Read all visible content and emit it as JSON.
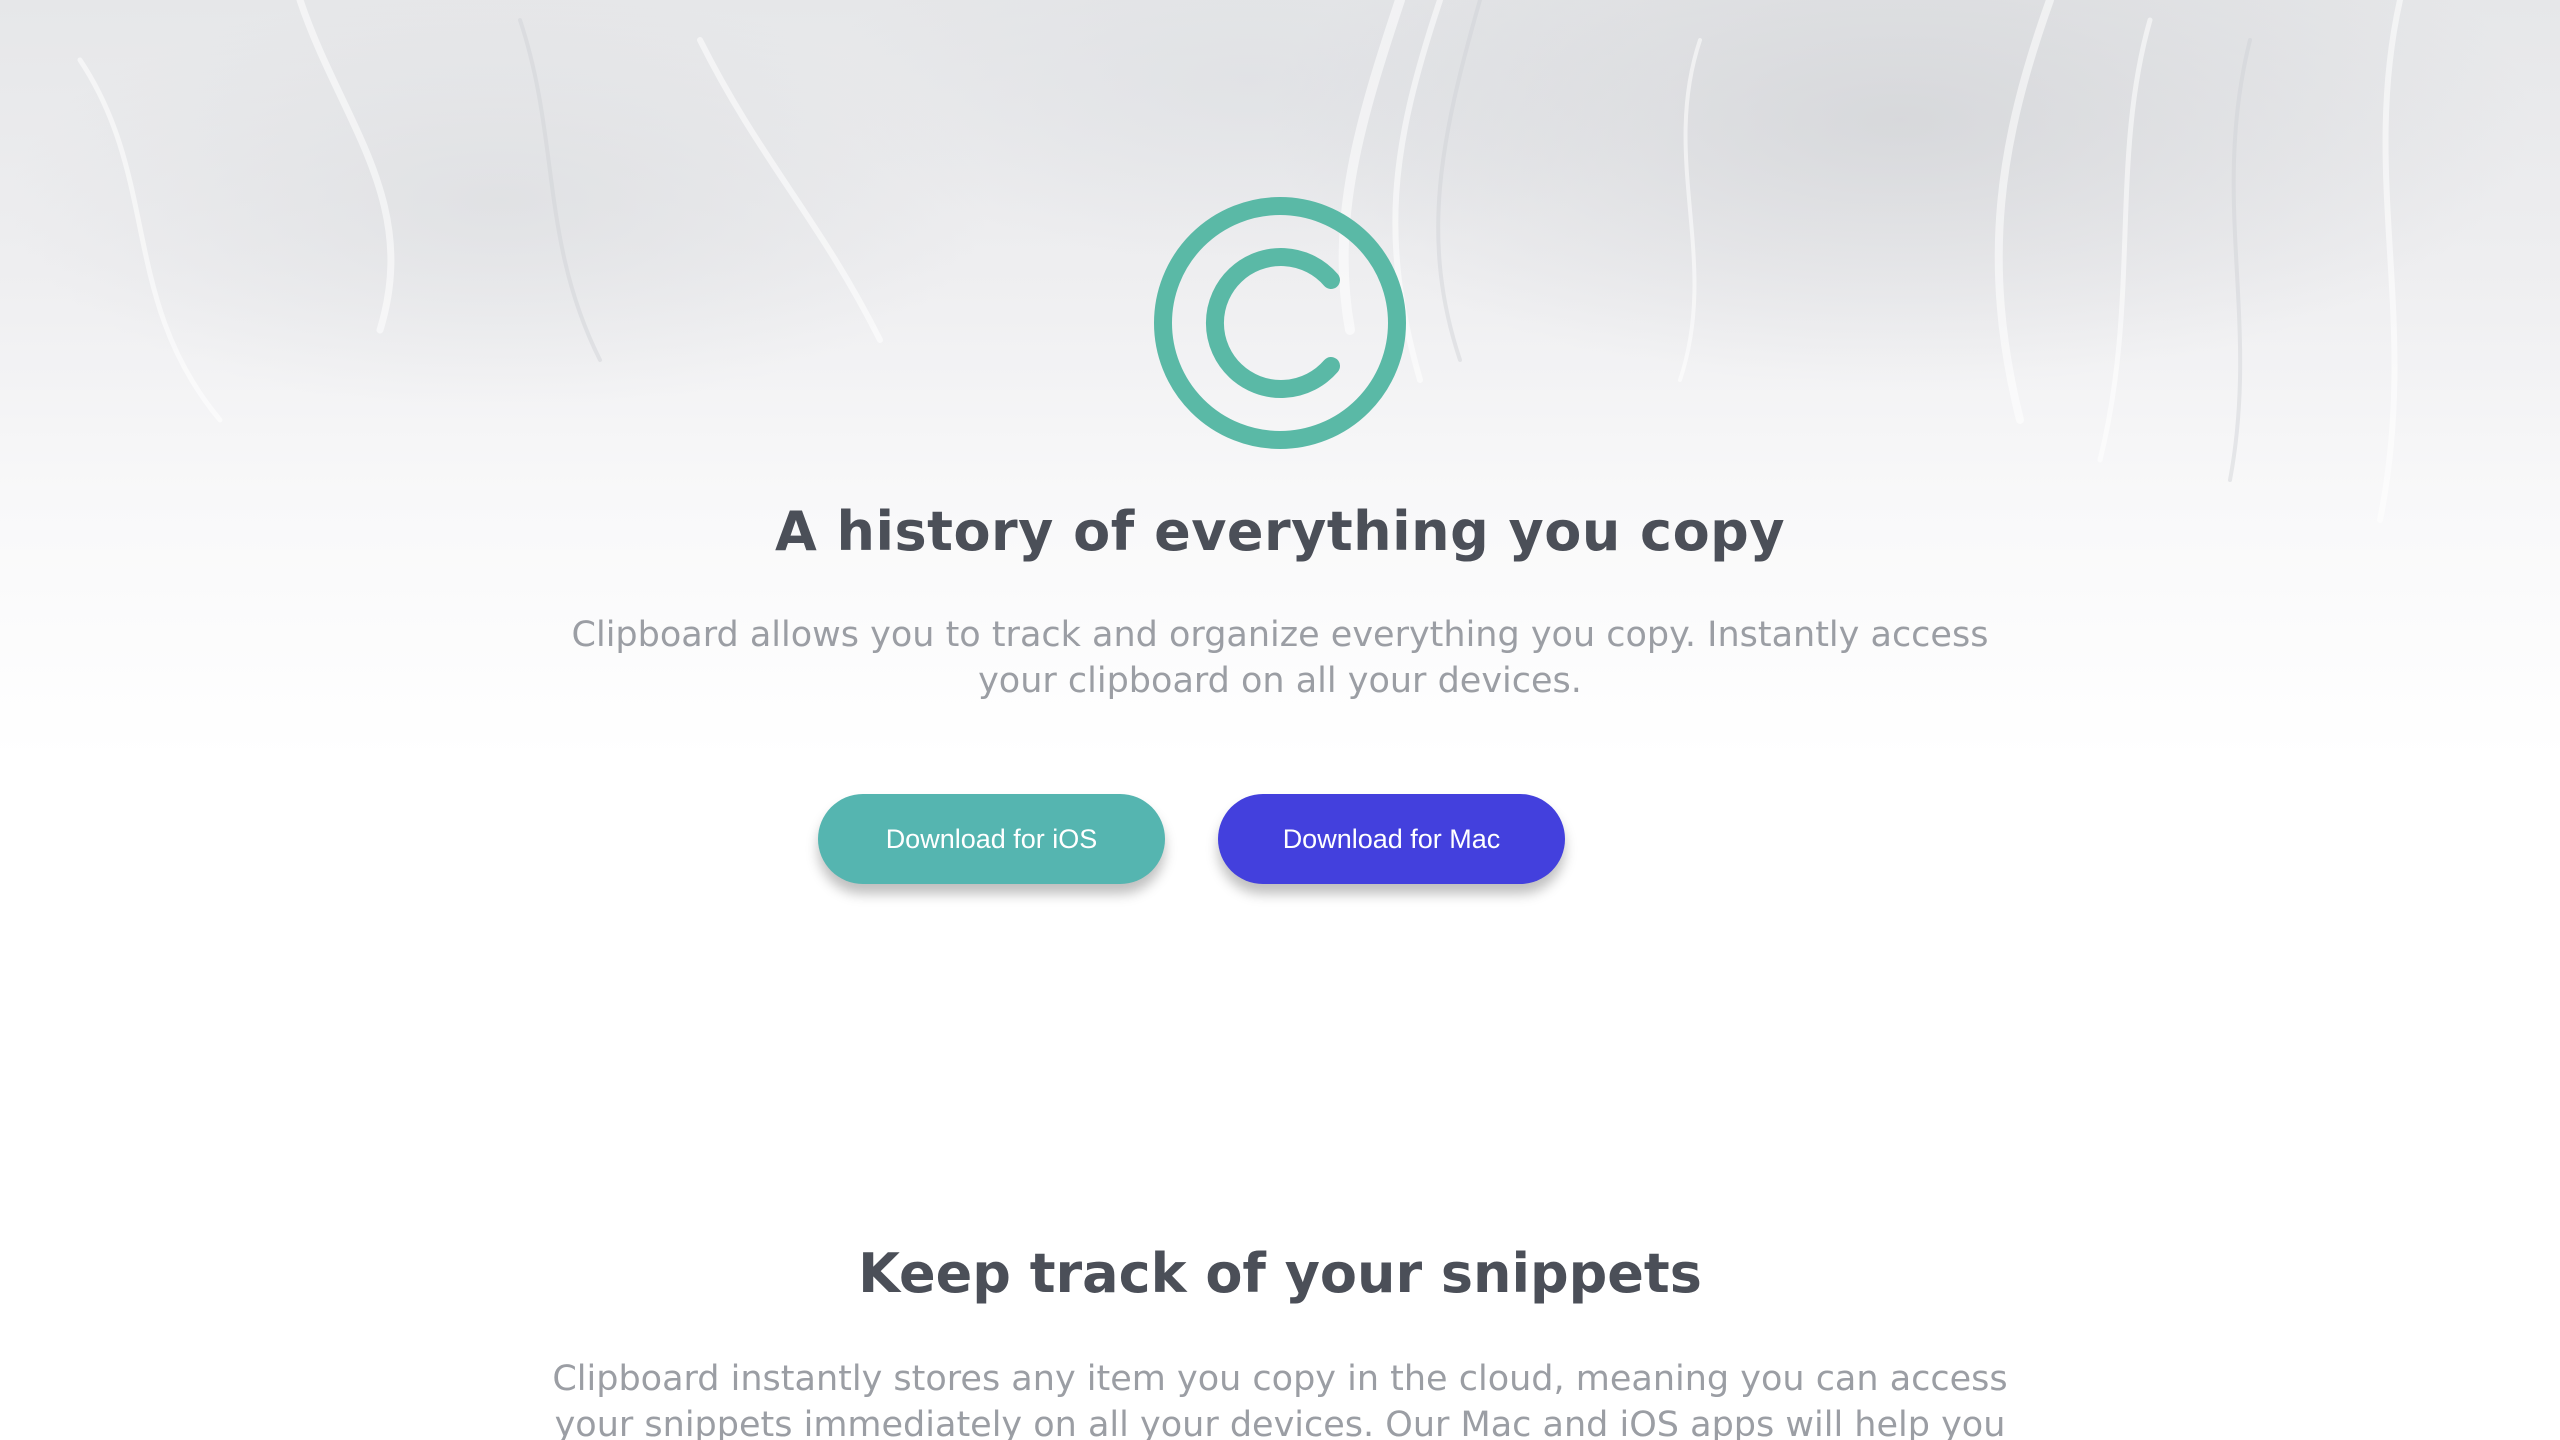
{
  "hero": {
    "logo_icon": "clipboard-copyright-icon",
    "logo_color": "#5ab9a6",
    "title": "A history of everything you copy",
    "subtitle": "Clipboard allows you to track and organize everything you copy. Instantly access your clipboard on all your devices."
  },
  "buttons": {
    "ios_label": "Download for iOS",
    "ios_color": "#55b5b0",
    "mac_label": "Download for Mac",
    "mac_color": "#4340dd"
  },
  "snippets": {
    "title": "Keep track of your snippets",
    "text": "Clipboard instantly stores any item you copy in the cloud, meaning you can access your snippets immediately on all your devices. Our Mac and iOS apps will help you organize"
  }
}
